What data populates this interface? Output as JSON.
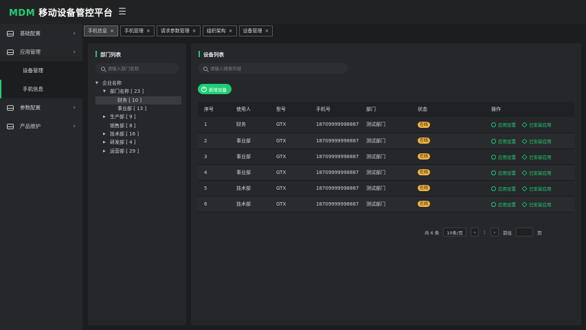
{
  "app": {
    "brand_mdm": "MDM",
    "brand_rest": " 移动设备管控平台",
    "menu_icon": "☰"
  },
  "sidebar": {
    "items": [
      {
        "label": "基础配置",
        "icon": "inbox-icon",
        "expandable": true
      },
      {
        "label": "应用管理",
        "icon": "inbox-icon",
        "expandable": true
      },
      {
        "label": "设备管理",
        "sub": true,
        "active": false
      },
      {
        "label": "手机信息",
        "sub": true,
        "active": true
      },
      {
        "label": "参数配置",
        "icon": "inbox-icon",
        "expandable": true
      },
      {
        "label": "产品维护",
        "icon": "inbox-icon",
        "expandable": true
      }
    ]
  },
  "tabs": [
    {
      "label": "手机信息",
      "active": true
    },
    {
      "label": "手机管理",
      "active": false
    },
    {
      "label": "请求参数管理",
      "active": false
    },
    {
      "label": "组织架构",
      "active": false
    },
    {
      "label": "设备管理",
      "active": false
    }
  ],
  "dept_panel": {
    "title": "部门列表",
    "search_placeholder": "请输入部门名称",
    "tree": [
      {
        "toggle": "▼",
        "label": "企业名称",
        "indent": 0
      },
      {
        "toggle": "▼",
        "label": "部门名称 [ 23 ]",
        "indent": 1
      },
      {
        "toggle": "",
        "label": "财务 [ 10 ]",
        "indent": 2,
        "selected": true
      },
      {
        "toggle": "",
        "label": "事业部 [ 13 ]",
        "indent": 2
      },
      {
        "toggle": "▶",
        "label": "生产部 [ 9 ]",
        "indent": 1
      },
      {
        "toggle": "",
        "label": "销售部 [ 8 ]",
        "indent": 1
      },
      {
        "toggle": "▶",
        "label": "技术部 [ 16 ]",
        "indent": 1
      },
      {
        "toggle": "▶",
        "label": "研发部 [ 4 ]",
        "indent": 1
      },
      {
        "toggle": "▶",
        "label": "运营部 [ 29 ]",
        "indent": 1
      }
    ]
  },
  "device_panel": {
    "title": "设备列表",
    "search_placeholder": "请输入搜索内容",
    "add_button": "新增设备",
    "columns": [
      "序号",
      "使用人",
      "型号",
      "手机号",
      "部门",
      "状态",
      "操作"
    ],
    "rows": [
      {
        "no": "1",
        "user": "财务",
        "model": "GTX",
        "phone": "18709999998887",
        "dept": "测试部门",
        "status": "在线"
      },
      {
        "no": "2",
        "user": "事业部",
        "model": "GTX",
        "phone": "18709999998887",
        "dept": "测试部门",
        "status": "在线"
      },
      {
        "no": "3",
        "user": "事业部",
        "model": "GTX",
        "phone": "18709999998887",
        "dept": "测试部门",
        "status": "在线"
      },
      {
        "no": "4",
        "user": "事业部",
        "model": "GTX",
        "phone": "18709999998887",
        "dept": "测试部门",
        "status": "在线"
      },
      {
        "no": "5",
        "user": "技术部",
        "model": "GTX",
        "phone": "18709999998887",
        "dept": "测试部门",
        "status": "在线"
      },
      {
        "no": "6",
        "user": "技术部",
        "model": "GTX",
        "phone": "18709999998887",
        "dept": "测试部门",
        "status": "在线"
      }
    ],
    "op_labels": {
      "settings": "应用设置",
      "installed": "已安装应用"
    },
    "pager": {
      "total": "共 6 条",
      "page_size": "10条/页",
      "prev": "‹",
      "current": "1",
      "next": "›",
      "goto": "前往",
      "unit": "页"
    }
  },
  "colors": {
    "accent": "#1fce73",
    "status": "#f2b33d"
  }
}
